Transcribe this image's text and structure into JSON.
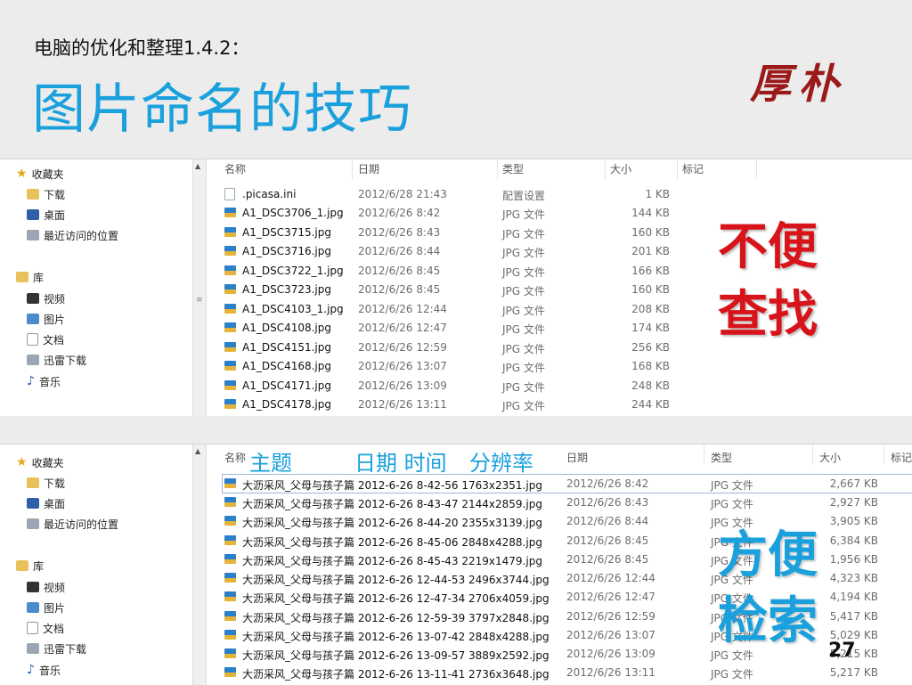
{
  "slide": {
    "subtitle": "电脑的优化和整理1.4.2：",
    "title": "图片命名的技巧",
    "logo": "厚朴",
    "page_number": "27",
    "colors": {
      "accent_blue": "#1aa0dc",
      "accent_red": "#d8141a"
    }
  },
  "annotations": {
    "bad_line1": "不便",
    "bad_line2": "查找",
    "good_line1": "方便",
    "good_line2": "检索",
    "subject": "主题",
    "datetime": "日期 时间",
    "resolution": "分辨率"
  },
  "nav": {
    "favorites": "收藏夹",
    "downloads": "下载",
    "desktop": "桌面",
    "recent": "最近访问的位置",
    "libraries": "库",
    "videos": "视频",
    "pictures": "图片",
    "documents": "文档",
    "thunder": "迅雷下载",
    "music": "音乐"
  },
  "explorer1": {
    "columns": {
      "name": "名称",
      "date": "日期",
      "type": "类型",
      "size": "大小",
      "tags": "标记"
    },
    "rows": [
      {
        "name": ".picasa.ini",
        "date": "2012/6/28 21:43",
        "type": "配置设置",
        "size": "1 KB"
      },
      {
        "name": "A1_DSC3706_1.jpg",
        "date": "2012/6/26 8:42",
        "type": "JPG 文件",
        "size": "144 KB"
      },
      {
        "name": "A1_DSC3715.jpg",
        "date": "2012/6/26 8:43",
        "type": "JPG 文件",
        "size": "160 KB"
      },
      {
        "name": "A1_DSC3716.jpg",
        "date": "2012/6/26 8:44",
        "type": "JPG 文件",
        "size": "201 KB"
      },
      {
        "name": "A1_DSC3722_1.jpg",
        "date": "2012/6/26 8:45",
        "type": "JPG 文件",
        "size": "166 KB"
      },
      {
        "name": "A1_DSC3723.jpg",
        "date": "2012/6/26 8:45",
        "type": "JPG 文件",
        "size": "160 KB"
      },
      {
        "name": "A1_DSC4103_1.jpg",
        "date": "2012/6/26 12:44",
        "type": "JPG 文件",
        "size": "208 KB"
      },
      {
        "name": "A1_DSC4108.jpg",
        "date": "2012/6/26 12:47",
        "type": "JPG 文件",
        "size": "174 KB"
      },
      {
        "name": "A1_DSC4151.jpg",
        "date": "2012/6/26 12:59",
        "type": "JPG 文件",
        "size": "256 KB"
      },
      {
        "name": "A1_DSC4168.jpg",
        "date": "2012/6/26 13:07",
        "type": "JPG 文件",
        "size": "168 KB"
      },
      {
        "name": "A1_DSC4171.jpg",
        "date": "2012/6/26 13:09",
        "type": "JPG 文件",
        "size": "248 KB"
      },
      {
        "name": "A1_DSC4178.jpg",
        "date": "2012/6/26 13:11",
        "type": "JPG 文件",
        "size": "244 KB"
      }
    ]
  },
  "explorer2": {
    "columns": {
      "name": "名称",
      "date": "日期",
      "type": "类型",
      "size": "大小",
      "tags": "标记"
    },
    "rows": [
      {
        "name": "大沥采风_父母与孩子篇 2012-6-26 8-42-56 1763x2351.jpg",
        "date": "2012/6/26 8:42",
        "type": "JPG 文件",
        "size": "2,667 KB"
      },
      {
        "name": "大沥采风_父母与孩子篇 2012-6-26 8-43-47 2144x2859.jpg",
        "date": "2012/6/26 8:43",
        "type": "JPG 文件",
        "size": "2,927 KB"
      },
      {
        "name": "大沥采风_父母与孩子篇 2012-6-26 8-44-20 2355x3139.jpg",
        "date": "2012/6/26 8:44",
        "type": "JPG 文件",
        "size": "3,905 KB"
      },
      {
        "name": "大沥采风_父母与孩子篇 2012-6-26 8-45-06 2848x4288.jpg",
        "date": "2012/6/26 8:45",
        "type": "JPG 文件",
        "size": "6,384 KB"
      },
      {
        "name": "大沥采风_父母与孩子篇 2012-6-26 8-45-43 2219x1479.jpg",
        "date": "2012/6/26 8:45",
        "type": "JPG 文件",
        "size": "1,956 KB"
      },
      {
        "name": "大沥采风_父母与孩子篇 2012-6-26 12-44-53 2496x3744.jpg",
        "date": "2012/6/26 12:44",
        "type": "JPG 文件",
        "size": "4,323 KB"
      },
      {
        "name": "大沥采风_父母与孩子篇 2012-6-26 12-47-34 2706x4059.jpg",
        "date": "2012/6/26 12:47",
        "type": "JPG 文件",
        "size": "4,194 KB"
      },
      {
        "name": "大沥采风_父母与孩子篇 2012-6-26 12-59-39 3797x2848.jpg",
        "date": "2012/6/26 12:59",
        "type": "JPG 文件",
        "size": "5,417 KB"
      },
      {
        "name": "大沥采风_父母与孩子篇 2012-6-26 13-07-42 2848x4288.jpg",
        "date": "2012/6/26 13:07",
        "type": "JPG 文件",
        "size": "5,029 KB"
      },
      {
        "name": "大沥采风_父母与孩子篇 2012-6-26 13-09-57 3889x2592.jpg",
        "date": "2012/6/26 13:09",
        "type": "JPG 文件",
        "size": "5,215 KB"
      },
      {
        "name": "大沥采风_父母与孩子篇 2012-6-26 13-11-41 2736x3648.jpg",
        "date": "2012/6/26 13:11",
        "type": "JPG 文件",
        "size": "5,217 KB"
      }
    ]
  }
}
